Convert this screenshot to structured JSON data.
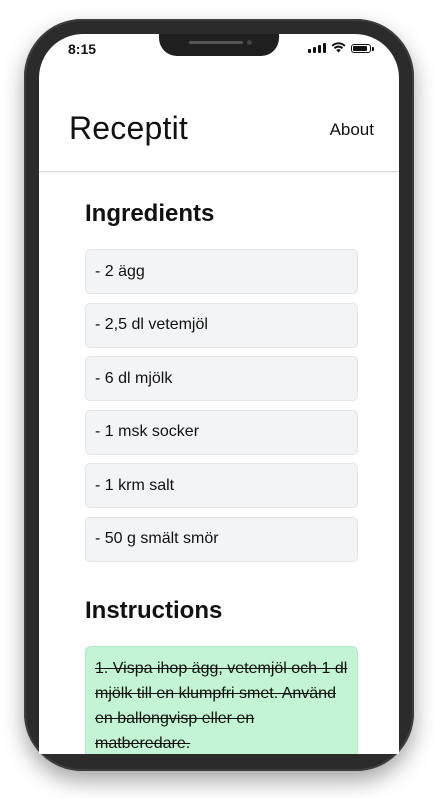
{
  "status_bar": {
    "time": "8:15"
  },
  "header": {
    "brand": "Receptit",
    "nav_about": "About"
  },
  "ingredients": {
    "title": "Ingredients",
    "items": [
      "- 2 ägg",
      "- 2,5 dl vetemjöl",
      "- 6 dl mjölk",
      "- 1 msk socker",
      "- 1 krm salt",
      "- 50 g smält smör"
    ]
  },
  "instructions": {
    "title": "Instructions",
    "steps": [
      {
        "text": "1. Vispa ihop ägg, vetemjöl och 1 dl mjölk till en klumpfri smet. Använd en ballongvisp eller en matberedare.",
        "completed": true
      }
    ]
  },
  "colors": {
    "step_done_bg": "#c3f4d3",
    "ingredient_bg": "#f3f4f6"
  }
}
